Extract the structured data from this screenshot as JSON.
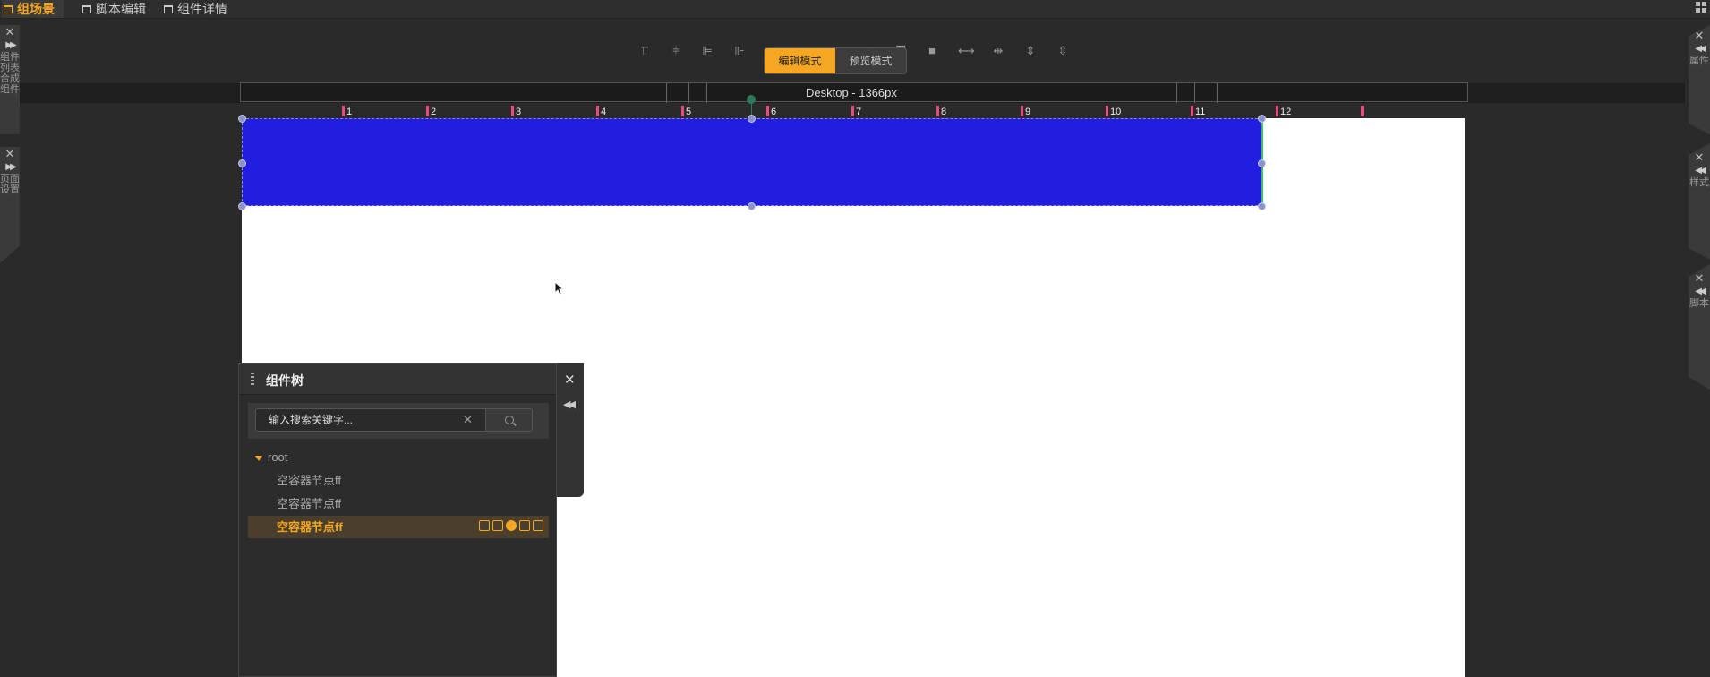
{
  "tabs": [
    {
      "label": "组场景",
      "active": true
    },
    {
      "label": "脚本编辑",
      "active": false
    },
    {
      "label": "组件详情",
      "active": false
    }
  ],
  "toolbar": {
    "tools": [
      "align-top-icon",
      "align-vcenter-icon",
      "align-left-icon",
      "align-right-icon",
      "align-hcenter-icon",
      "align-bottom-icon",
      "layer-up-icon",
      "layer-down-icon",
      "bring-front-icon",
      "send-back-icon",
      "distribute-h-icon",
      "space-h-icon",
      "distribute-v-icon",
      "space-v-icon"
    ],
    "edit_mode": "编辑模式",
    "preview_mode": "预览模式"
  },
  "device": {
    "label": "Desktop - 1366px"
  },
  "columns": [
    "1",
    "2",
    "3",
    "4",
    "5",
    "6",
    "7",
    "8",
    "9",
    "10",
    "11",
    "12"
  ],
  "left_panels": [
    {
      "label": "组件列表"
    },
    {
      "label": "合成组件"
    },
    {
      "label": "页面设置"
    }
  ],
  "right_panels": [
    {
      "label": "属性"
    },
    {
      "label": "样式"
    },
    {
      "label": "脚本"
    }
  ],
  "tree": {
    "title": "组件树",
    "search_placeholder": "输入搜索关键字...",
    "root_label": "root",
    "nodes": [
      {
        "label": "空容器节点ff",
        "selected": false
      },
      {
        "label": "空容器节点ff",
        "selected": false
      },
      {
        "label": "空容器节点ff",
        "selected": true
      }
    ]
  },
  "colors": {
    "accent": "#f5a623",
    "selection": "#221ee0",
    "ruler_mark": "#e94a7c"
  }
}
